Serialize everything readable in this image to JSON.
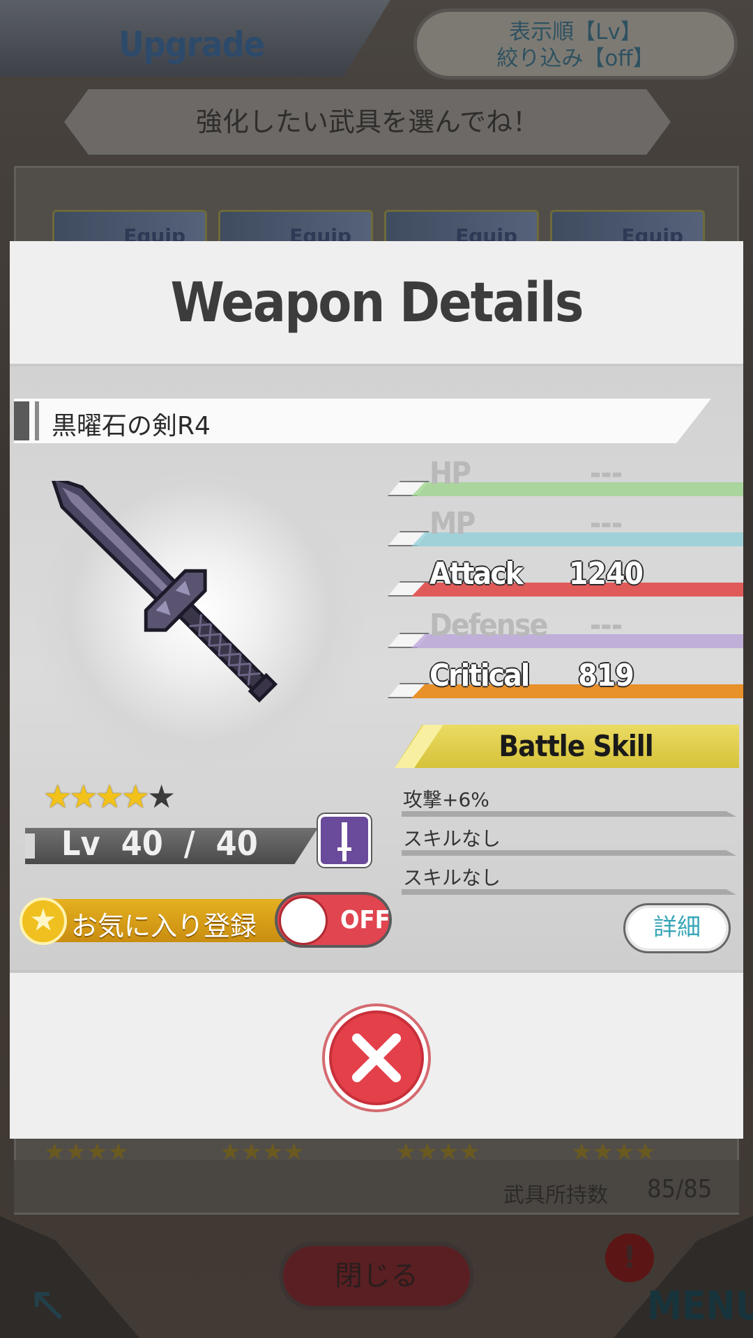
{
  "background": {
    "screen_title": "Upgrade",
    "sort_line1": "表示順【Lv】",
    "sort_line2": "絞り込み【off】",
    "instruction": "強化したい武具を選んでね！",
    "card_label": "Equip",
    "count_label": "武具所持数",
    "count_value": "85/85",
    "close_label": "閉じる",
    "menu_label": "MENU",
    "alert_badge": "!"
  },
  "modal": {
    "title": "Weapon Details",
    "weapon_name": "黒曜石の剣R4",
    "rarity": {
      "filled": 4,
      "total": 5
    },
    "level_text": "Lv  40  /  40",
    "weapon_type_icon": "sword-icon",
    "favorite_label": "お気に入り登録",
    "favorite_toggle_label": "OFF",
    "stats": [
      {
        "label": "HP",
        "value": "---",
        "active": false,
        "color": "#9bd48a"
      },
      {
        "label": "MP",
        "value": "---",
        "active": false,
        "color": "#8fcfd8"
      },
      {
        "label": "Attack",
        "value": "1240",
        "active": true,
        "color": "#e05a5a"
      },
      {
        "label": "Defense",
        "value": "---",
        "active": false,
        "color": "#b7a0d8"
      },
      {
        "label": "Critical",
        "value": "819",
        "active": true,
        "color": "#e8902a"
      }
    ],
    "battle_skill_header": "Battle Skill",
    "skills": [
      "攻撃+6%",
      "スキルなし",
      "スキルなし"
    ],
    "detail_button": "詳細"
  }
}
